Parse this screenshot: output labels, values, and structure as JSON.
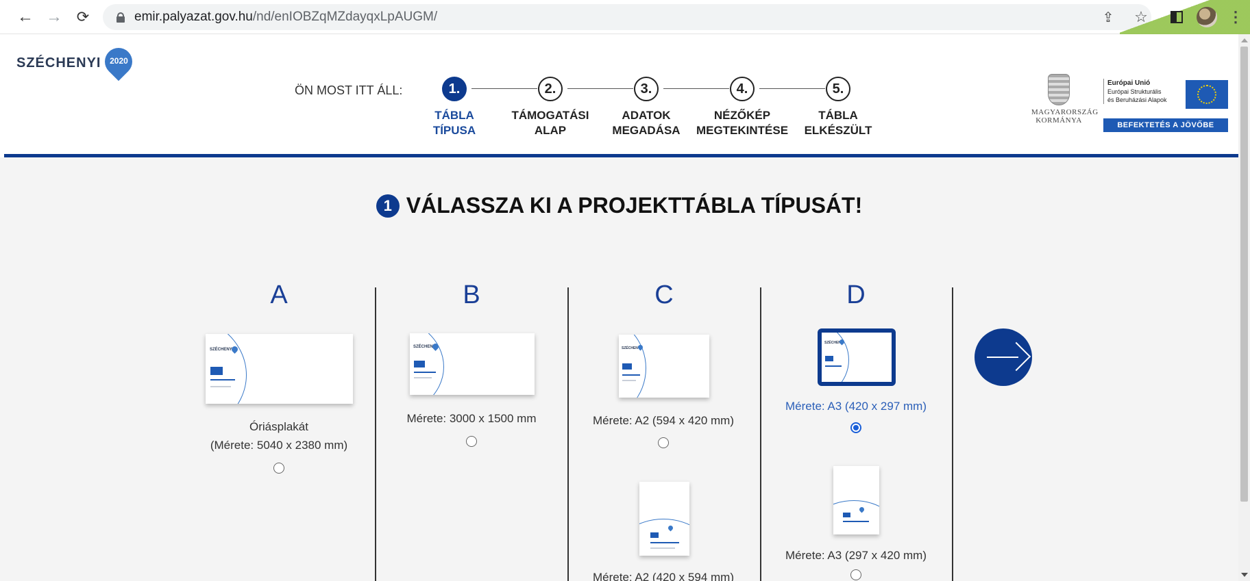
{
  "browser": {
    "url_host": "emir.palyazat.gov.hu",
    "url_path": "/nd/enIOBZqMZdayqxLpAUGM/"
  },
  "header": {
    "brand": "SZÉCHENYI",
    "brand_badge": "2020",
    "location_label": "ÖN MOST ITT ÁLL:",
    "steps": [
      {
        "num": "1.",
        "line1": "TÁBLA",
        "line2": "TÍPUSA",
        "active": true
      },
      {
        "num": "2.",
        "line1": "TÁMOGATÁSI",
        "line2": "ALAP",
        "active": false
      },
      {
        "num": "3.",
        "line1": "ADATOK",
        "line2": "MEGADÁSA",
        "active": false
      },
      {
        "num": "4.",
        "line1": "NÉZŐKÉP",
        "line2": "MEGTEKINTÉSE",
        "active": false
      },
      {
        "num": "5.",
        "line1": "TÁBLA",
        "line2": "ELKÉSZÜLT",
        "active": false
      }
    ],
    "gov_line1": "MAGYARORSZÁG",
    "gov_line2": "KORMÁNYA",
    "eu_line1": "Európai Unió",
    "eu_line2": "Európai Strukturális",
    "eu_line3": "és Beruházási Alapok",
    "eu_bar": "BEFEKTETÉS A JÖVŐBE"
  },
  "main": {
    "title_num": "1",
    "title": "VÁLASSZA KI A PROJEKTTÁBLA TÍPUSÁT!",
    "columns": [
      {
        "letter": "A",
        "caption1": "Óriásplakát",
        "caption2": "(Mérete: 5040 x 2380 mm)"
      },
      {
        "letter": "B",
        "caption1": "Mérete: 3000 x 1500 mm"
      },
      {
        "letter": "C",
        "caption1": "Mérete: A2 (594 x 420 mm)",
        "caption2": "Mérete: A2 (420 x 594 mm)"
      },
      {
        "letter": "D",
        "caption1": "Mérete: A3 (420 x 297 mm)",
        "caption2": "Mérete: A3 (297 x 420 mm)"
      }
    ],
    "selected_option": "D - Mérete: A3 (420 x 297 mm)"
  },
  "colors": {
    "brand_blue": "#0d3a8e",
    "accent_blue": "#1a3f96",
    "background": "#f4f4f4"
  }
}
